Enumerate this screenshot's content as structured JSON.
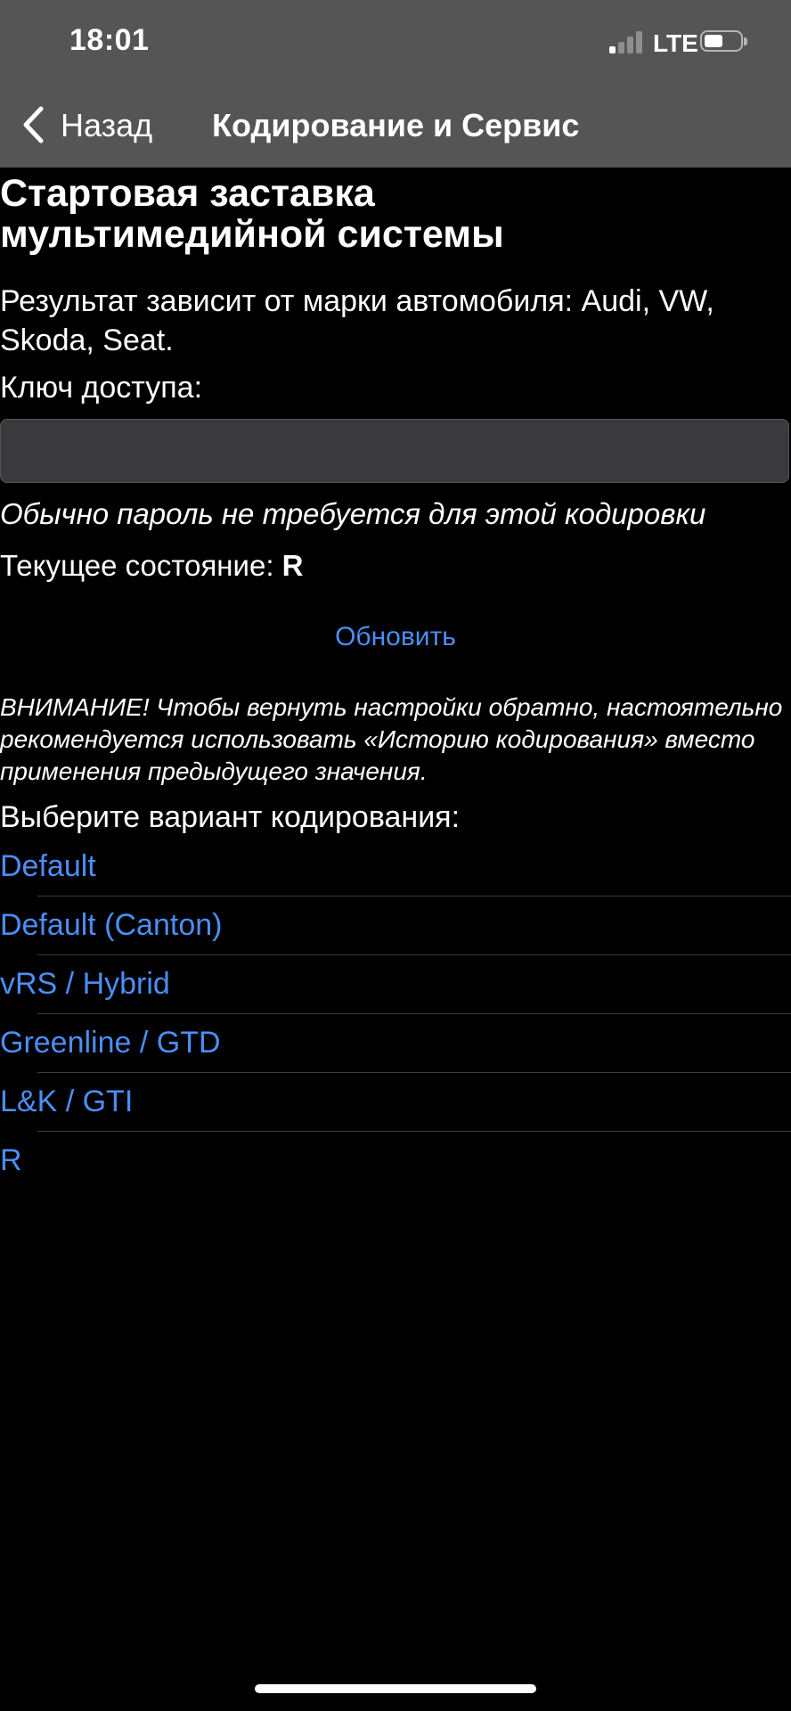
{
  "status_bar": {
    "time": "18:01",
    "network": "LTE",
    "signal_icon": "signal-icon",
    "battery_icon": "battery-icon"
  },
  "nav": {
    "back_label": "Назад",
    "back_icon": "chevron-left-icon",
    "title": "Кодирование и Сервис"
  },
  "page": {
    "title": "Стартовая заставка мультимедийной системы",
    "description": "Результат зависит от марки автомобиля: Audi, VW, Skoda, Seat.",
    "key_label": "Ключ доступа:",
    "key_value": "",
    "hint": "Обычно пароль не требуется для этой кодировки",
    "current_label": "Текущее состояние:",
    "current_value": "R",
    "refresh_label": "Обновить",
    "warning": "ВНИМАНИЕ! Чтобы вернуть настройки обратно, настоятельно рекомендуется использовать «Историю кодирования» вместо применения предыдущего значения.",
    "choose_label": "Выберите вариант кодирования:",
    "options": [
      "Default",
      "Default (Canton)",
      "vRS / Hybrid",
      "Greenline / GTD",
      "L&K / GTI",
      "R"
    ]
  },
  "colors": {
    "background": "#000000",
    "nav_bar": "#555555",
    "link": "#4b8ef5",
    "input_bg": "#3a3a3c"
  }
}
